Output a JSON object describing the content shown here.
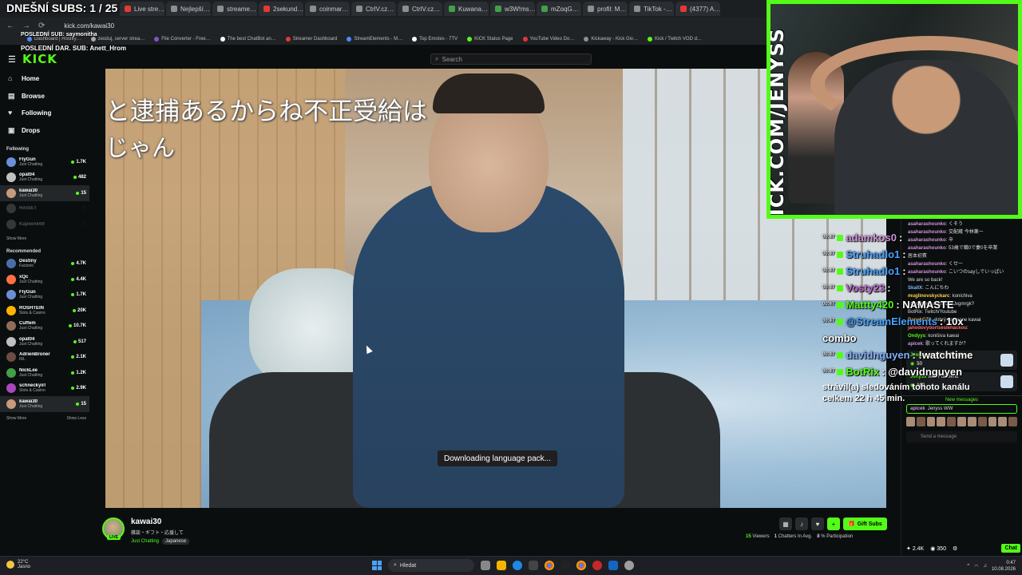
{
  "overlay": {
    "subs_goal": "DNEŠNÍ SUBS: 1 / 25",
    "last_sub": "POSLEDNÍ SUB: saymonitha",
    "last_gift": "POSLEDNÍ DAR. SUB: Anett_Hrom",
    "webcam_text": "KICK.COM/JENYSS"
  },
  "browser": {
    "tabs": [
      "Live stre…",
      "Nejlepší…",
      "streame…",
      "2sekund…",
      "coinmar…",
      "CtrlV.cz…",
      "CtrlV.cz…",
      "Kuwana…",
      "w3W!ms…",
      "mZoqG…",
      "profil: M…",
      "TikTok -…",
      "(4377) A…"
    ],
    "tab_colors": [
      "#e53935",
      "#8e8e8e",
      "#8e8e8e",
      "#e53935",
      "#8e8e8e",
      "#8e8e8e",
      "#8e8e8e",
      "#43a047",
      "#43a047",
      "#43a047",
      "#8e8e8e",
      "#8e8e8e",
      "#e53935"
    ],
    "url": "kick.com/kawai30",
    "bookmarks": [
      "Dashboard | Hostify…",
      "zeoduj, server strea…",
      "File Converter - Free…",
      "The best ChatBot an…",
      "Streamer Dashboard",
      "StreamElements - M…",
      "Top Emotes - 7TV",
      "KICK Status Page",
      "YouTube Video Do…",
      "Kickaway - Kick Giv…",
      "Kick / Twitch VOD d…"
    ],
    "bookmark_colors": [
      "#4a8cff",
      "#aaaaaa",
      "#7e57c2",
      "#ffffff",
      "#e53935",
      "#4a8cff",
      "#ffffff",
      "#53fc18",
      "#e53935",
      "#8e8e8e",
      "#53fc18"
    ]
  },
  "kick": {
    "logo": "KICK",
    "search_placeholder": "Search",
    "nav": [
      {
        "label": "Home",
        "icon": "home-icon",
        "glyph": "⌂"
      },
      {
        "label": "Browse",
        "icon": "browse-icon",
        "glyph": "▤"
      },
      {
        "label": "Following",
        "icon": "heart-icon",
        "glyph": "♥"
      },
      {
        "label": "Drops",
        "icon": "drops-icon",
        "glyph": "▣"
      }
    ],
    "following_title": "Following",
    "following": [
      {
        "name": "FlyGun",
        "cat": "Just Chatting",
        "viewers": "1.7K",
        "color": "#6b8fd6",
        "online": true,
        "selected": false
      },
      {
        "name": "opat04",
        "cat": "Just Chatting",
        "viewers": "482",
        "color": "#c0c0c0",
        "online": true,
        "selected": false
      },
      {
        "name": "kawai30",
        "cat": "Just Chatting",
        "viewers": "15",
        "color": "#c89b7b",
        "online": true,
        "selected": true
      },
      {
        "name": "HAISET",
        "cat": "",
        "viewers": "",
        "color": "#888888",
        "online": false,
        "selected": false
      },
      {
        "name": "Kapeenk69",
        "cat": "",
        "viewers": "",
        "color": "#888888",
        "online": false,
        "selected": false
      }
    ],
    "show_more": "Show More",
    "recommended_title": "Recommended",
    "recommended": [
      {
        "name": "Destiny",
        "cat": "Factorio",
        "viewers": "4.7K",
        "color": "#4b6ea8",
        "selected": false
      },
      {
        "name": "xQc",
        "cat": "Just Chatting",
        "viewers": "4.4K",
        "color": "#ff7043",
        "selected": false
      },
      {
        "name": "FlyGun",
        "cat": "Just Chatting",
        "viewers": "1.7K",
        "color": "#6b8fd6",
        "selected": false
      },
      {
        "name": "ROSHTEIN",
        "cat": "Slots & Casino",
        "viewers": "20K",
        "color": "#ffb300",
        "selected": false
      },
      {
        "name": "Cuffem",
        "cat": "Just Chatting",
        "viewers": "10.7K",
        "color": "#8e6e5a",
        "selected": false
      },
      {
        "name": "opat04",
        "cat": "Just Chatting",
        "viewers": "517",
        "color": "#c0c0c0",
        "selected": false
      },
      {
        "name": "AdrienBroner",
        "cat": "IRL",
        "viewers": "2.1K",
        "color": "#6d4c41",
        "selected": false
      },
      {
        "name": "NickLee",
        "cat": "Just Chatting",
        "viewers": "1.2K",
        "color": "#43a047",
        "selected": false
      },
      {
        "name": "schneckyirl",
        "cat": "Slots & Casino",
        "viewers": "2.9K",
        "color": "#ab47bc",
        "selected": false
      },
      {
        "name": "kawai30",
        "cat": "Just Chatting",
        "viewers": "15",
        "color": "#c89b7b",
        "selected": true
      }
    ],
    "show_more_2": "Show More",
    "show_less": "Show Less"
  },
  "video": {
    "subtitle_line1": "と逮捕あるからね不正受給は",
    "subtitle_line2": "じゃん",
    "toast": "Downloading language pack..."
  },
  "stream_info": {
    "streamer": "kawai30",
    "title": "雑談・ギフト・応援して",
    "category": "Just Chatting",
    "tag": "Japanese",
    "live_badge": "LIVE",
    "gift_subs": "Gift Subs",
    "viewers_count": "15",
    "viewers_label": "Viewers",
    "chatters_count": "1",
    "chatters_label": "Chatters In Avg.",
    "participation_count": "8",
    "participation_label": "% Participation"
  },
  "chat": {
    "messages": [
      {
        "user": "asaharashounko",
        "text": "くそう",
        "cls": "u5"
      },
      {
        "user": "asaharashounko",
        "text": "交配蔵 今林薬ー",
        "cls": "u5"
      },
      {
        "user": "asaharashounko",
        "text": "辛",
        "cls": "u5"
      },
      {
        "user": "asaharashounko",
        "text": "53歳で職0で妻0を卒業",
        "cls": "u5"
      },
      {
        "user": "",
        "text": "居本初賓",
        "cls": "u5"
      },
      {
        "user": "asaharashounko",
        "text": "くせー",
        "cls": "u5"
      },
      {
        "user": "asaharashounko",
        "text": "こいつのsayしでいっぱい",
        "cls": "u5"
      },
      {
        "user": "",
        "text": "We are so back!",
        "cls": "u2"
      },
      {
        "user": "SkallX",
        "text": "こんにちわ",
        "cls": "u4"
      },
      {
        "user": "muglinovskyckarc",
        "text": "konichiva",
        "cls": "u3"
      },
      {
        "user": "",
        "text": "https://youtu.be/KCtwJxgmrgk?",
        "cls": "u2"
      },
      {
        "user": "",
        "text": "BotRix: Twitch/Youtube",
        "cls": "u2"
      },
      {
        "user": "DanekCZ2",
        "text": "dobrý den pane kawai",
        "cls": "u6"
      },
      {
        "user": "jahodovydortsesIehackou",
        "text": "",
        "cls": "u1"
      },
      {
        "user": "Ondyys",
        "text": "koniŝiva kawai",
        "cls": "u2"
      },
      {
        "user": "apicek",
        "text": "歌ってくれますか？",
        "cls": "u5"
      }
    ],
    "gift_cards": [
      {
        "user": "Jenyss",
        "action": "sent Skull Emoji",
        "points": "50"
      },
      {
        "user": "Jenyss",
        "action": "sent Full Send",
        "points": "100"
      }
    ],
    "new_messages": "New messages",
    "pinned_user": "apicek",
    "pinned_text": "Jenyss WW",
    "send_placeholder": "Send a message",
    "footer_points": "2.4K",
    "footer_coins": "350",
    "chat_button": "Chat"
  },
  "overlay_chat": [
    {
      "time": "00:47",
      "user": "adamkos0",
      "text": ":",
      "color": "#ce93d8"
    },
    {
      "time": "00:47",
      "user": "Struhadlo1",
      "text": ":",
      "color": "#4aa3ff"
    },
    {
      "time": "00:47",
      "user": "Struhadlo1",
      "text": ":",
      "color": "#4aa3ff"
    },
    {
      "time": "00:47",
      "user": "Vosty23",
      "text": ":",
      "color": "#ba68c8"
    },
    {
      "time": "00:47",
      "user": "Mattty420",
      "text": ": NAMASTE",
      "color": "#53fc18"
    },
    {
      "time": "00:47",
      "user": "@StreamElements",
      "text": ": 10x",
      "color": "#4aa3ff"
    },
    {
      "time": "",
      "user": "",
      "text": "combo",
      "color": "#ffffff"
    },
    {
      "time": "00:47",
      "user": "davidnguyen",
      "text": ": !watchtime",
      "color": "#82b1ff"
    },
    {
      "time": "00:47",
      "user": "BotRix",
      "text": ": @davidnguyen",
      "color": "#53fc18"
    }
  ],
  "overlay_follow": "strávil(a) sledováním tohoto kanálu celkem 22 h 45 min.",
  "taskbar": {
    "temp": "22°C",
    "weather": "Jasno",
    "search": "Hledat",
    "time": "0:47",
    "date": "10.08.2026"
  }
}
